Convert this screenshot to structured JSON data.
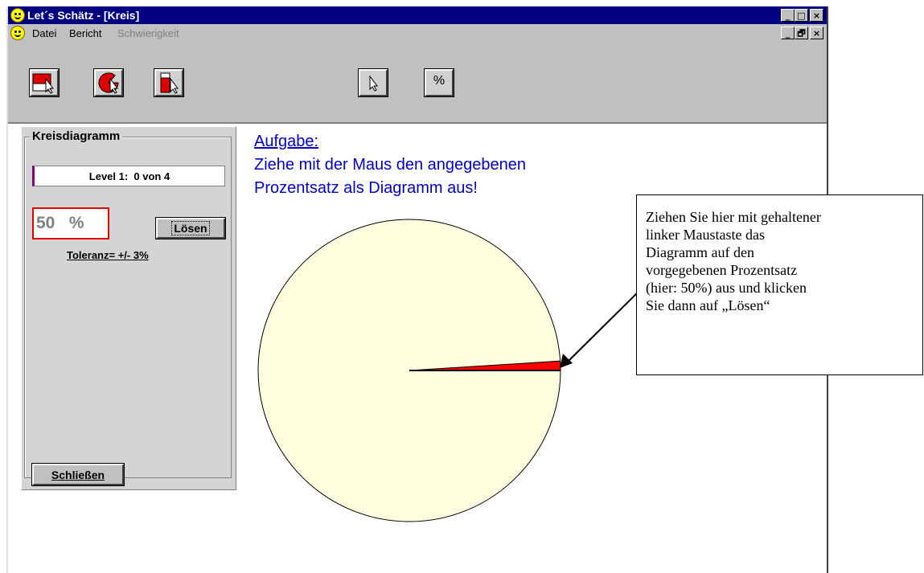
{
  "window": {
    "title": "Let´s Schätz - [Kreis]",
    "controls": {
      "minimize": "_",
      "maximize": "□",
      "close": "×",
      "restore": "🗗"
    }
  },
  "menu": {
    "datei": "Datei",
    "bericht": "Bericht",
    "schwierigkeit": "Schwierigkeit"
  },
  "toolbar": {
    "percent_label": "%"
  },
  "panel": {
    "group_title": "Kreisdiagramm",
    "level_text": "Level 1:  0 von 4",
    "percent_value": "50   %",
    "solve_label": "Lösen",
    "tolerance": "Toleranz= +/- 3%",
    "close_label": "Schließen"
  },
  "task": {
    "heading": "Aufgabe:",
    "line1": "Ziehe mit der Maus den angegebenen",
    "line2": "Prozentsatz als Diagramm aus!"
  },
  "pie": {
    "fill_color": "#ffffe0",
    "slice_color": "#ff0000",
    "slice_percent": 1
  },
  "callout": {
    "lines": [
      "Ziehen Sie hier mit gehaltener",
      "linker Maustaste das",
      "Diagramm auf den",
      "vorgegebenen Prozentsatz",
      "(hier: 50%) aus und klicken",
      "Sie dann auf „Lösen“"
    ]
  }
}
